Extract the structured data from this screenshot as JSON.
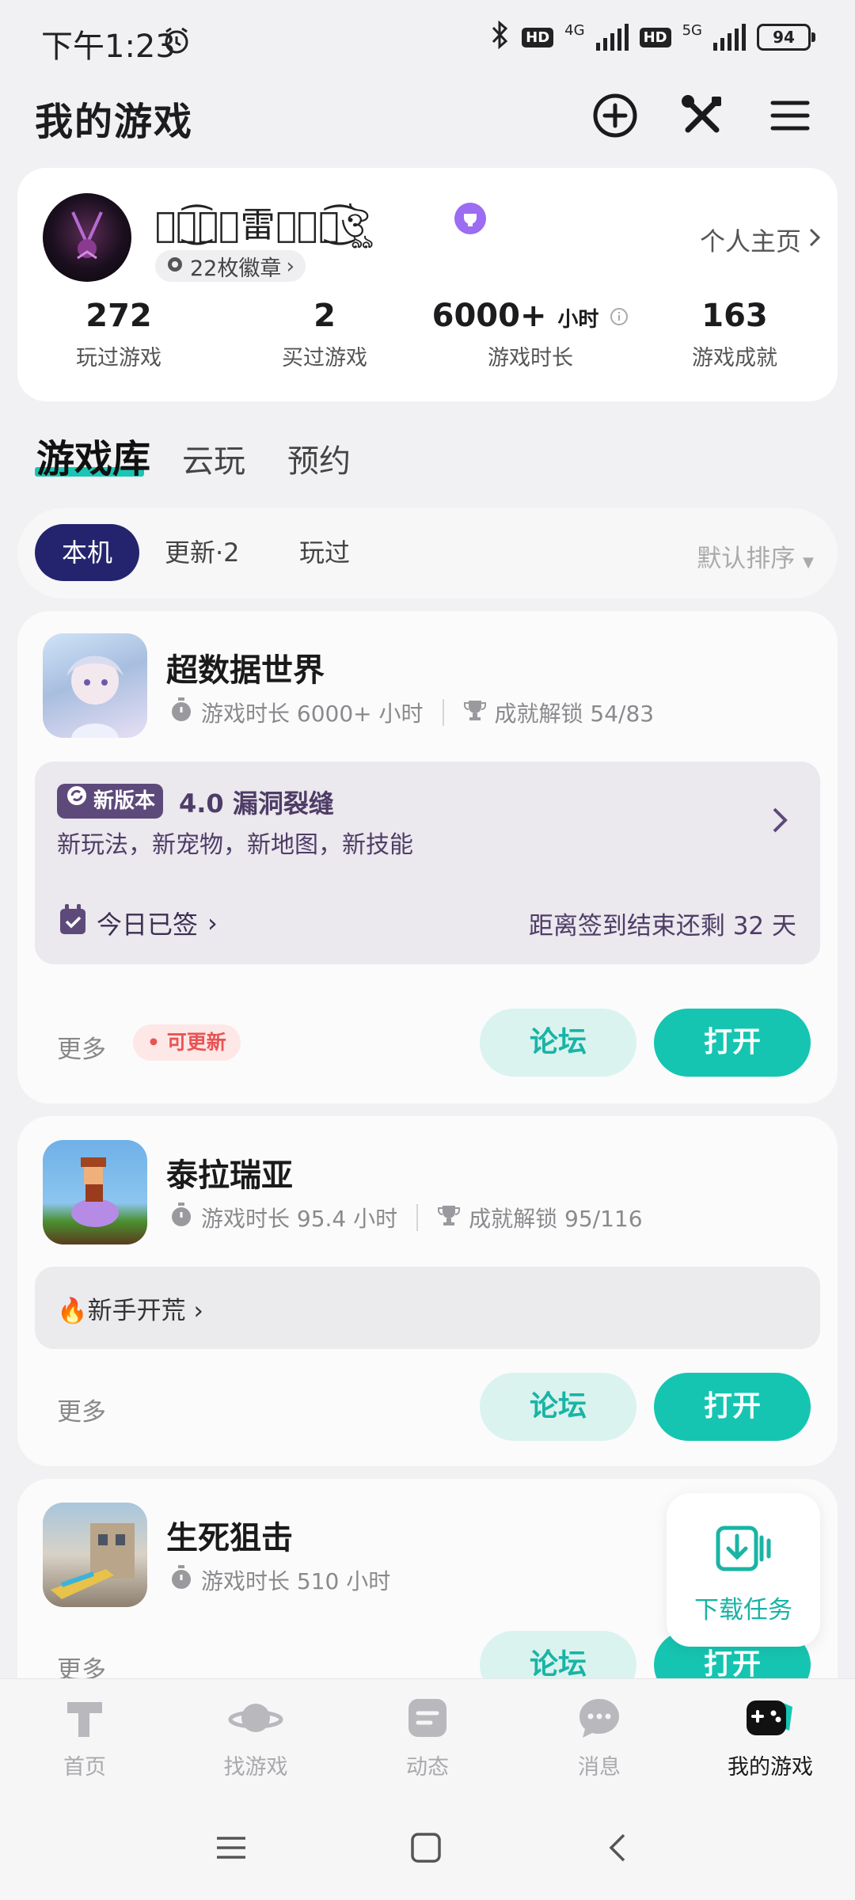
{
  "status_bar": {
    "time": "下午1:23",
    "network_1": "4G",
    "network_2": "5G",
    "hd_label": "HD",
    "battery": "94"
  },
  "header": {
    "title": "我的游戏",
    "icons": [
      "plus-circle-icon",
      "tools-icon",
      "menu-icon"
    ]
  },
  "profile": {
    "username": "ঔৣ͜͡ঔ⃝雷ঔ⃝ঔ͜͡ঔৣ",
    "badges": "22枚徽章",
    "homepage_link": "个人主页",
    "stats": [
      {
        "value": "272",
        "unit": "",
        "label": "玩过游戏"
      },
      {
        "value": "2",
        "unit": "",
        "label": "买过游戏"
      },
      {
        "value": "6000+",
        "unit": "小时",
        "label": "游戏时长"
      },
      {
        "value": "163",
        "unit": "",
        "label": "游戏成就"
      }
    ]
  },
  "library_tabs": [
    "游戏库",
    "云玩",
    "预约"
  ],
  "filters": {
    "chips": [
      "本机",
      "更新·2",
      "玩过"
    ],
    "sort": "默认排序"
  },
  "games": [
    {
      "name": "超数据世界",
      "playtime": "游戏时长 6000+ 小时",
      "achievements": "成就解锁 54/83",
      "promo": {
        "badge": "新版本",
        "title": "4.0 漏洞裂缝",
        "desc": "新玩法，新宠物，新地图，新技能",
        "checkin": "今日已签",
        "remaining": "距离签到结束还剩 32 天"
      },
      "more": "更多",
      "update_badge": "可更新",
      "forum": "论坛",
      "open": "打开"
    },
    {
      "name": "泰拉瑞亚",
      "playtime": "游戏时长 95.4 小时",
      "achievements": "成就解锁 95/116",
      "event": "🔥新手开荒",
      "more": "更多",
      "forum": "论坛",
      "open": "打开"
    },
    {
      "name": "生死狙击",
      "playtime": "游戏时长 510 小时",
      "more": "更多",
      "forum": "论坛",
      "open": "打开"
    }
  ],
  "download_fab": {
    "label": "下载任务"
  },
  "bottom_nav": [
    {
      "label": "首页",
      "icon": "home-icon"
    },
    {
      "label": "找游戏",
      "icon": "planet-icon"
    },
    {
      "label": "动态",
      "icon": "feed-icon"
    },
    {
      "label": "消息",
      "icon": "message-icon"
    },
    {
      "label": "我的游戏",
      "icon": "gamepad-icon"
    }
  ],
  "colors": {
    "accent": "#16c5b1",
    "chip_active": "#24246e",
    "update_red": "#e95353",
    "vip_purple": "#9c6cf2"
  }
}
